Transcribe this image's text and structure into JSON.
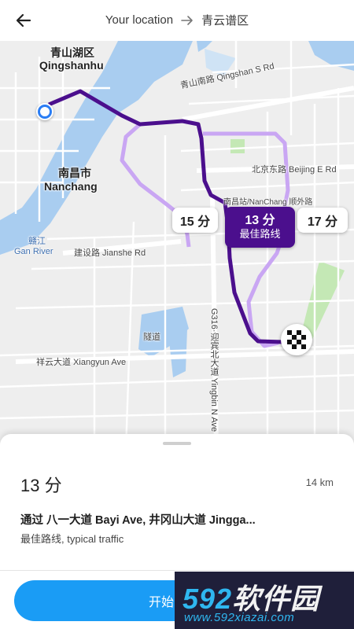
{
  "header": {
    "origin": "Your location",
    "destination": "青云谱区",
    "back_icon": "arrow-left-icon",
    "separator_icon": "arrow-right-icon"
  },
  "map": {
    "place_labels": {
      "district_cn": "青山湖区",
      "district_en": "Qingshanhu",
      "city_cn": "南昌市",
      "city_en": "Nanchang",
      "river_cn": "赣江",
      "river_en": "Gan River",
      "road_qingshan": "青山南路 Qingshan S Rd",
      "road_beijing": "北京东路 Beijing E Rd",
      "road_jianshe": "建设路 Jianshe Rd",
      "road_xiangyun": "祥云大道 Xiangyun Ave",
      "road_g316": "G316·迎宾北大道 Yingbin N Ave",
      "tunnel": "隧道",
      "station": "南昌站/NanChang 顺外路"
    },
    "route_callouts": {
      "alt_left": "15 分",
      "best_time": "13 分",
      "best_label": "最佳路线",
      "alt_right": "17 分"
    },
    "colors": {
      "best_route": "#4b0f8d",
      "alt_route": "#c9a6f3",
      "water": "#a9cdf0",
      "land": "#eeeeee",
      "park": "#c4e8b5"
    },
    "markers": {
      "origin_icon": "current-location-icon",
      "destination_icon": "checkered-flag-icon"
    }
  },
  "route_sheet": {
    "eta": "13 分",
    "distance": "14 km",
    "via": "通过 八一大道 Bayi Ave, 井冈山大道 Jingga...",
    "traffic": "最佳路线, typical traffic",
    "start_label": "开始"
  },
  "watermark": {
    "brand_number": "592",
    "brand_text": "软件园",
    "url": "www.592xiazai.com"
  }
}
